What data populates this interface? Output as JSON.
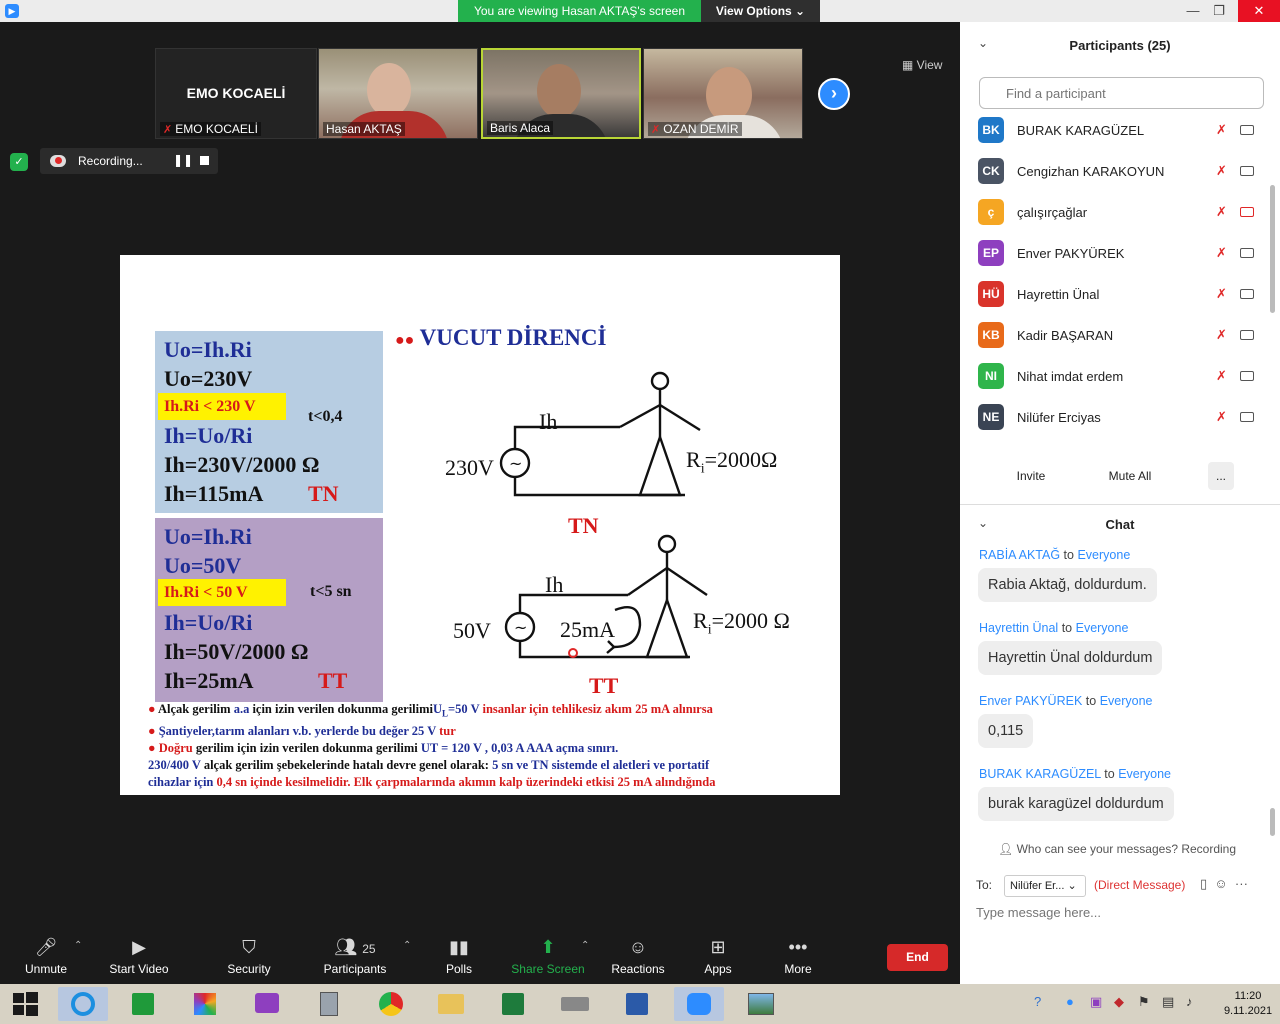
{
  "titlebar": {
    "banner": "You are viewing Hasan AKTAŞ's screen",
    "view_options": "View Options",
    "minimize": "—",
    "restore": "❐",
    "close": "✕"
  },
  "tiles": [
    {
      "name": "EMO KOCAELİ",
      "big_label": "EMO KOCAELİ",
      "muted": true
    },
    {
      "name": "Hasan AKTAŞ",
      "muted": false
    },
    {
      "name": "Baris Alaca",
      "muted": false
    },
    {
      "name": "OZAN DEMİR",
      "muted": true
    }
  ],
  "meeting": {
    "view_label": "View",
    "recording_label": "Recording..."
  },
  "slide": {
    "title": "VUCUT DİRENCİ",
    "tn_box": {
      "l1": "Uo=Ih.Ri",
      "l2": "Uo=230V",
      "highlight": "Ih.Ri < 230 V",
      "time": "t<0,4",
      "l3": "Ih=Uo/Ri",
      "l4": "Ih=230V/2000 Ω",
      "l5": "Ih=115mA",
      "tag": "TN"
    },
    "tt_box": {
      "l1": "Uo=Ih.Ri",
      "l2": "Uo=50V",
      "highlight": "Ih.Ri < 50 V",
      "time": "t<5 sn",
      "l3": "Ih=Uo/Ri",
      "l4": "Ih=50V/2000 Ω",
      "l5": "Ih=25mA",
      "tag": "TT"
    },
    "diag1": {
      "source": "230V",
      "ih": "Ih",
      "r_main": "R",
      "r_sub": "i",
      "r_val": "=2000Ω",
      "tag": "TN"
    },
    "diag2": {
      "source": "50V",
      "ih": "Ih",
      "current": "25mA",
      "r_main": "R",
      "r_sub": "i",
      "r_val": "=2000 Ω",
      "tag": "TT"
    },
    "notes": {
      "n1a": "Alçak gerilim ",
      "n1b": "a.a",
      "n1c": " için izin verilen dokunma gerilimi",
      "n1d": "U",
      "n1e": "L",
      "n1f": "=50 V",
      "n1g": "  insanlar için tehlikesiz akım 25 mA alınırsa",
      "n2a": "Şantiyeler,tarım alanları v.b. yerlerde  bu değer ",
      "n2b": "25 V",
      "n2c": " tur",
      "n3a": "Doğru",
      "n3b": " gerilim için izin verilen dokunma gerilimi ",
      "n3c": "UT = 120 V ,  0,03 A   AAA açma sınırı.",
      "n4a": "230/400 V",
      "n4b": " alçak  gerilim şebekelerinde hatalı devre genel olarak:  ",
      "n4c": "5 sn ve TN sistemde  el aletleri ve portatif",
      "n5a": "cihazlar için  ",
      "n5b": "0,4 sn içinde kesilmelidir.",
      "n5c": " Elk çarpmalarında akımın kalp üzerindeki etkisi 25 mA alındığında"
    }
  },
  "toolbar": {
    "unmute": "Unmute",
    "start_video": "Start Video",
    "security": "Security",
    "participants": "Participants",
    "participants_count": "25",
    "polls": "Polls",
    "share_screen": "Share Screen",
    "reactions": "Reactions",
    "apps": "Apps",
    "more": "More",
    "end": "End"
  },
  "participants": {
    "header": "Participants (25)",
    "search_placeholder": "Find a participant",
    "list": [
      {
        "initials": "BK",
        "name": "BURAK KARAGÜZEL",
        "color": "#1f78c8",
        "cam_off": false
      },
      {
        "initials": "CK",
        "name": "Cengizhan KARAKOYUN",
        "color": "#4a5464",
        "cam_off": false
      },
      {
        "initials": "ç",
        "name": "çalışırçağlar",
        "color": "#f5a623",
        "cam_off": true
      },
      {
        "initials": "EP",
        "name": "Enver PAKYÜREK",
        "color": "#8e3fbf",
        "cam_off": false
      },
      {
        "initials": "HÜ",
        "name": "Hayrettin Ünal",
        "color": "#d9342b",
        "cam_off": false
      },
      {
        "initials": "KB",
        "name": "Kadir BAŞARAN",
        "color": "#e86a1a",
        "cam_off": false
      },
      {
        "initials": "NI",
        "name": "Nihat imdat erdem",
        "color": "#2fb54b",
        "cam_off": false
      },
      {
        "initials": "NE",
        "name": "Nilüfer Erciyas",
        "color": "#3a4454",
        "cam_off": false
      }
    ],
    "invite": "Invite",
    "mute_all": "Mute All",
    "more": "..."
  },
  "chat": {
    "header": "Chat",
    "to_word": "to",
    "messages": [
      {
        "from": "RABİA AKTAĞ",
        "to": "Everyone",
        "text": "Rabia Aktağ, doldurdum."
      },
      {
        "from": "Hayrettin Ünal",
        "to": "Everyone",
        "text": "Hayrettin Ünal doldurdum"
      },
      {
        "from": "Enver PAKYÜREK",
        "to": "Everyone",
        "text": "0,115"
      },
      {
        "from": "BURAK KARAGÜZEL",
        "to": "Everyone",
        "text": "burak karagüzel doldurdum"
      }
    ],
    "who_can_see": "Who can see your messages? Recording",
    "to_label": "To:",
    "to_value": "Nilüfer Er...",
    "direct": "(Direct Message)",
    "input_placeholder": "Type message here..."
  },
  "taskbar": {
    "time": "11:20",
    "date": "9.11.2021"
  }
}
